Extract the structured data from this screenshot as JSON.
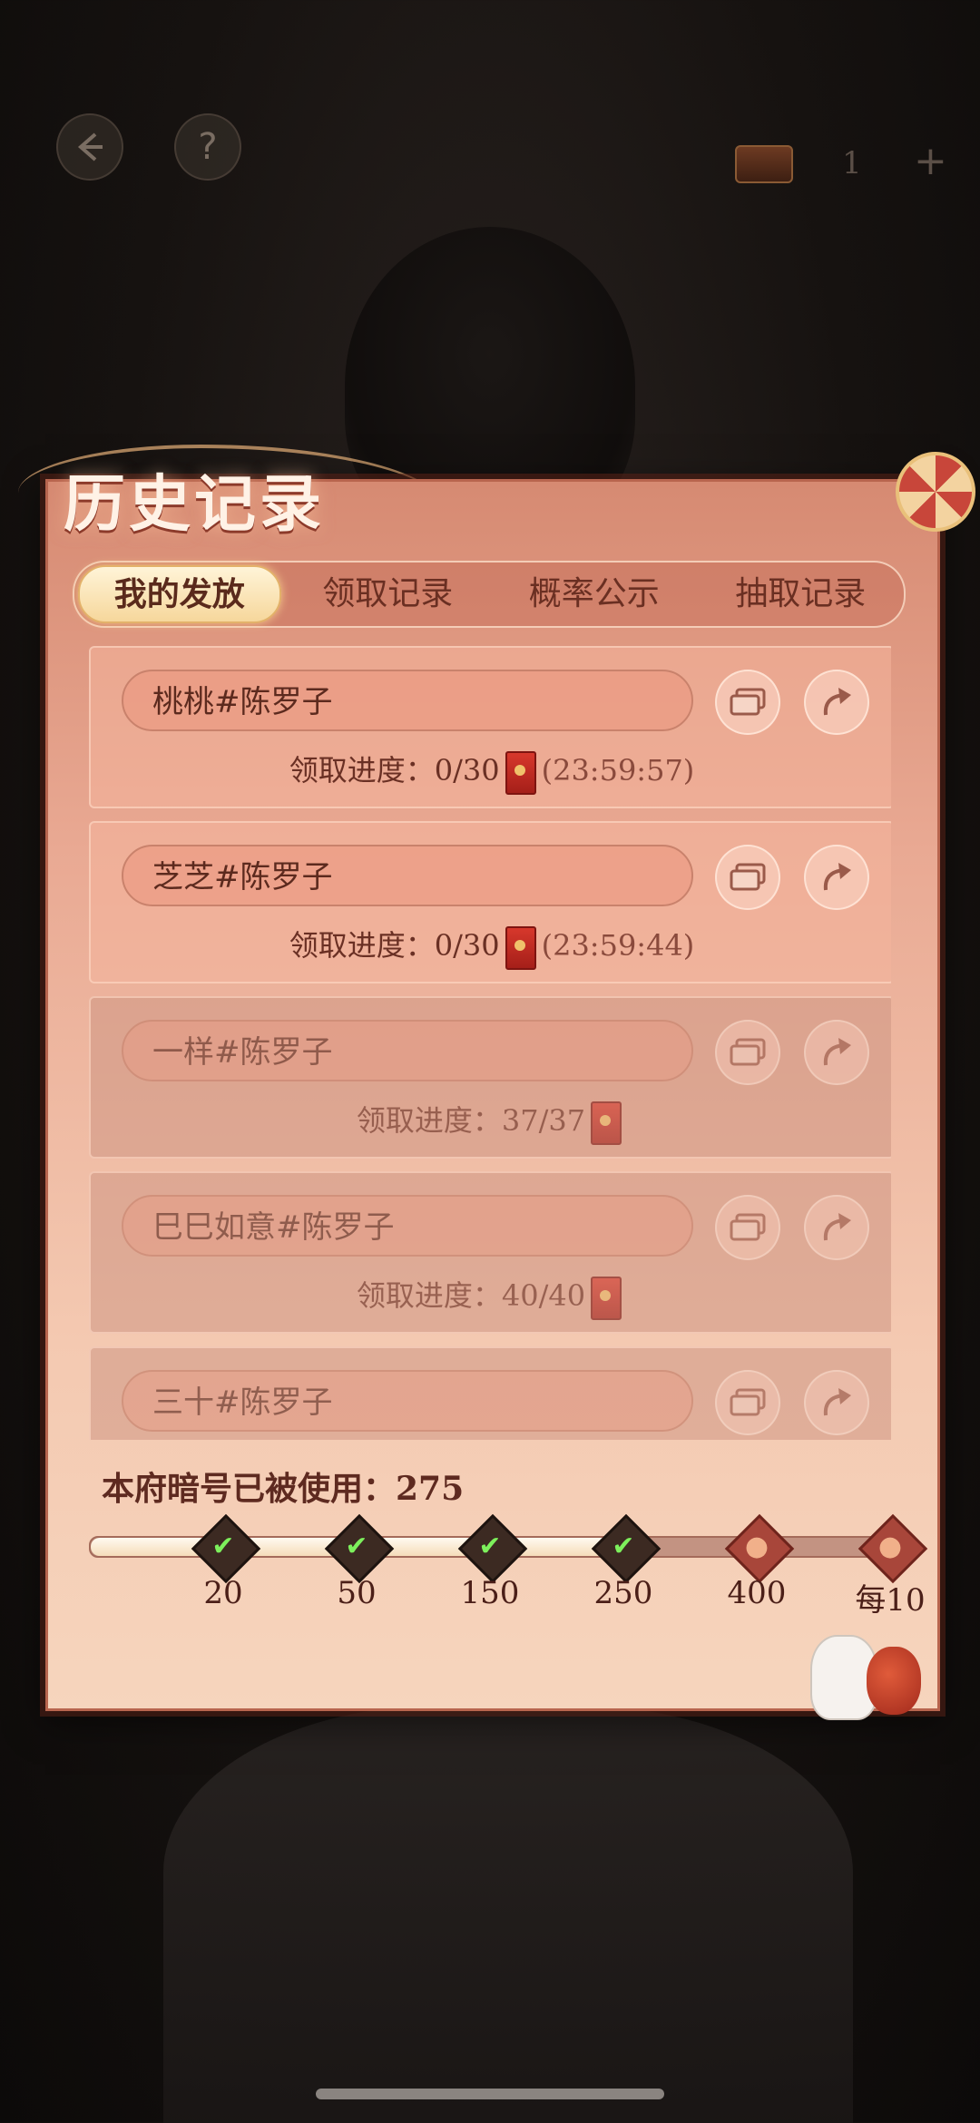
{
  "topbar": {
    "back_icon": "back-arrow-icon",
    "help_label": "?",
    "chest_count": "1",
    "plus_label": "+"
  },
  "panel": {
    "title": "历史记录"
  },
  "tabs": [
    {
      "label": "我的发放",
      "active": true
    },
    {
      "label": "领取记录",
      "active": false
    },
    {
      "label": "概率公示",
      "active": false
    },
    {
      "label": "抽取记录",
      "active": false
    }
  ],
  "records": [
    {
      "name": "桃桃#陈罗子",
      "progress_label": "领取进度：0/30",
      "countdown": "(23:59:57)",
      "done": false
    },
    {
      "name": "芝芝#陈罗子",
      "progress_label": "领取进度：0/30",
      "countdown": "(23:59:44)",
      "done": false
    },
    {
      "name": "一样#陈罗子",
      "progress_label": "领取进度：37/37",
      "countdown": "",
      "done": true
    },
    {
      "name": "巳巳如意#陈罗子",
      "progress_label": "领取进度：40/40",
      "countdown": "",
      "done": true
    },
    {
      "name": "三十#陈罗子",
      "progress_label": "",
      "countdown": "",
      "done": true
    }
  ],
  "usage": {
    "label": "本府暗号已被使用：275",
    "value": 275
  },
  "milestones": [
    {
      "label": "20",
      "reached": true
    },
    {
      "label": "50",
      "reached": true
    },
    {
      "label": "150",
      "reached": true
    },
    {
      "label": "250",
      "reached": true
    },
    {
      "label": "400",
      "reached": false
    },
    {
      "label": "每10",
      "reached": false
    }
  ],
  "colors": {
    "panel_top": "#d68a72",
    "panel_bottom": "#f6d5bd",
    "accent_gold": "#f6d79c",
    "reached_check": "#7df05c"
  }
}
